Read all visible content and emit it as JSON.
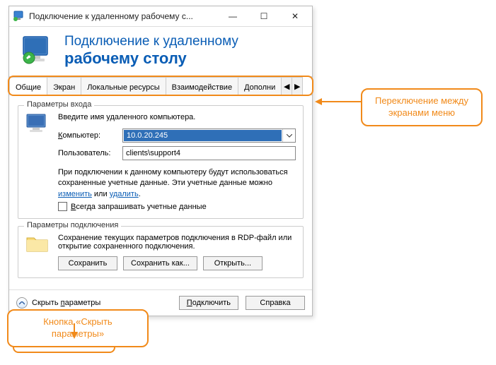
{
  "window": {
    "title": "Подключение к удаленному рабочему с...",
    "minimize": "—",
    "maximize": "☐",
    "close": "✕"
  },
  "header": {
    "line1": "Подключение к удаленному",
    "line2": "рабочему столу"
  },
  "tabs": {
    "items": [
      "Общие",
      "Экран",
      "Локальные ресурсы",
      "Взаимодействие",
      "Дополни"
    ],
    "scroll_left": "◀",
    "scroll_right": "▶",
    "active_index": 0
  },
  "login_group": {
    "title": "Параметры входа",
    "intro": "Введите имя удаленного компьютера.",
    "computer_label": "Компьютер:",
    "computer_value": "10.0.20.245",
    "user_label": "Пользователь:",
    "user_value": "clients\\support4",
    "note_pre": "При подключении к данному компьютеру будут использоваться сохраненные учетные данные.  Эти учетные данные можно ",
    "note_link1": "изменить",
    "note_mid": " или ",
    "note_link2": "удалить",
    "note_post": ".",
    "always_ask": "Всегда запрашивать учетные данные"
  },
  "conn_group": {
    "title": "Параметры подключения",
    "desc": "Сохранение текущих параметров подключения в RDP-файл или открытие сохраненного подключения.",
    "save": "Сохранить",
    "save_as": "Сохранить как...",
    "open": "Открыть..."
  },
  "footer": {
    "hide": "Скрыть параметры",
    "connect": "Подключить",
    "help": "Справка"
  },
  "callouts": {
    "right": "Переключение между экранами меню",
    "left": "Кнопка «Скрыть параметры»"
  }
}
